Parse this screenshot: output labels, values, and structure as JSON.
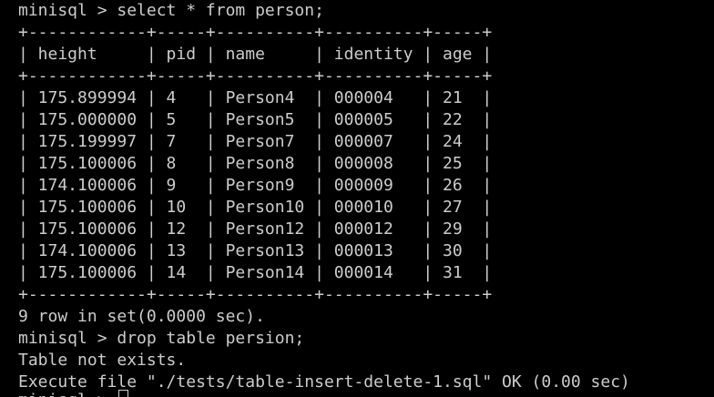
{
  "terminal": {
    "lines": [
      "minisql > select * from person;",
      "+------------+-----+----------+----------+-----+",
      "| height     | pid | name     | identity | age |",
      "+------------+-----+----------+----------+-----+",
      "| 175.899994 | 4   | Person4  | 000004   | 21  |",
      "| 175.000000 | 5   | Person5  | 000005   | 22  |",
      "| 175.199997 | 7   | Person7  | 000007   | 24  |",
      "| 175.100006 | 8   | Person8  | 000008   | 25  |",
      "| 174.100006 | 9   | Person9  | 000009   | 26  |",
      "| 175.100006 | 10  | Person10 | 000010   | 27  |",
      "| 175.100006 | 12  | Person12 | 000012   | 29  |",
      "| 174.100006 | 13  | Person13 | 000013   | 30  |",
      "| 175.100006 | 14  | Person14 | 000014   | 31  |",
      "+------------+-----+----------+----------+-----+",
      "9 row in set(0.0000 sec).",
      "minisql > drop table persion;",
      "Table not exists.",
      "Execute file \"./tests/table-insert-delete-1.sql\" OK (0.00 sec)",
      "minisql > "
    ]
  }
}
